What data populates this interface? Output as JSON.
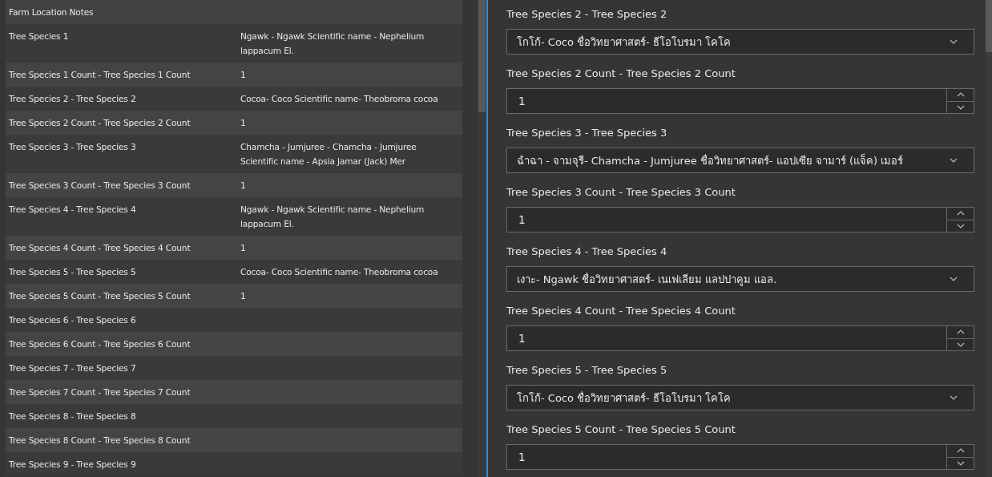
{
  "details_table": {
    "section_title": "Farm Location Notes",
    "rows": [
      {
        "label": "Tree Species 1",
        "value": "Ngawk - Ngawk Scientific name - Nephelium lappacum El."
      },
      {
        "label": "Tree Species 1 Count - Tree Species 1 Count",
        "value": "1"
      },
      {
        "label": "Tree Species 2 - Tree Species 2",
        "value": "Cocoa- Coco Scientific name- Theobroma cocoa"
      },
      {
        "label": "Tree Species 2 Count - Tree Species 2 Count",
        "value": "1"
      },
      {
        "label": "Tree Species 3 - Tree Species 3",
        "value": "Chamcha - Jumjuree - Chamcha - Jumjuree Scientific name - Apsia Jamar (Jack) Mer"
      },
      {
        "label": "Tree Species 3 Count - Tree Species 3 Count",
        "value": "1"
      },
      {
        "label": "Tree Species 4 - Tree Species 4",
        "value": "Ngawk - Ngawk Scientific name - Nephelium lappacum El."
      },
      {
        "label": "Tree Species 4 Count - Tree Species 4 Count",
        "value": "1"
      },
      {
        "label": "Tree Species 5 - Tree Species 5",
        "value": "Cocoa- Coco Scientific name- Theobroma cocoa"
      },
      {
        "label": "Tree Species 5 Count - Tree Species 5 Count",
        "value": "1"
      },
      {
        "label": "Tree Species 6 - Tree Species 6"
      },
      {
        "label": "Tree Species 6 Count - Tree Species 6 Count"
      },
      {
        "label": "Tree Species 7 - Tree Species 7"
      },
      {
        "label": "Tree Species 7 Count - Tree Species 7 Count"
      },
      {
        "label": "Tree Species 8 - Tree Species 8"
      },
      {
        "label": "Tree Species 8 Count - Tree Species 8 Count"
      },
      {
        "label": "Tree Species 9 - Tree Species 9"
      }
    ]
  },
  "form": {
    "fields": [
      {
        "kind": "select",
        "label": "Tree Species 2 - Tree Species 2",
        "value": "โกโก้- Coco ชื่อวิทยาศาสตร์- ธีโอโบรมา โคโค"
      },
      {
        "kind": "number",
        "label": "Tree Species 2 Count - Tree Species 2 Count",
        "value": "1"
      },
      {
        "kind": "select",
        "label": "Tree Species 3 - Tree Species 3",
        "value": "ฉำฉา - จามจุรี- Chamcha - Jumjuree ชื่อวิทยาศาสตร์- แอปเซีย จามาร์ (แจ็ค) เมอร์"
      },
      {
        "kind": "number",
        "label": "Tree Species 3 Count - Tree Species 3 Count",
        "value": "1"
      },
      {
        "kind": "select",
        "label": "Tree Species 4 - Tree Species 4",
        "value": "เงาะ- Ngawk ชื่อวิทยาศาสตร์- เนเฟเลียม แลปปาคูม แอล."
      },
      {
        "kind": "number",
        "label": "Tree Species 4 Count - Tree Species 4 Count",
        "value": "1"
      },
      {
        "kind": "select",
        "label": "Tree Species 5 - Tree Species 5",
        "value": "โกโก้- Coco ชื่อวิทยาศาสตร์- ธีโอโบรมา โคโค"
      },
      {
        "kind": "number",
        "label": "Tree Species 5 Count - Tree Species 5 Count",
        "value": "1"
      }
    ]
  }
}
